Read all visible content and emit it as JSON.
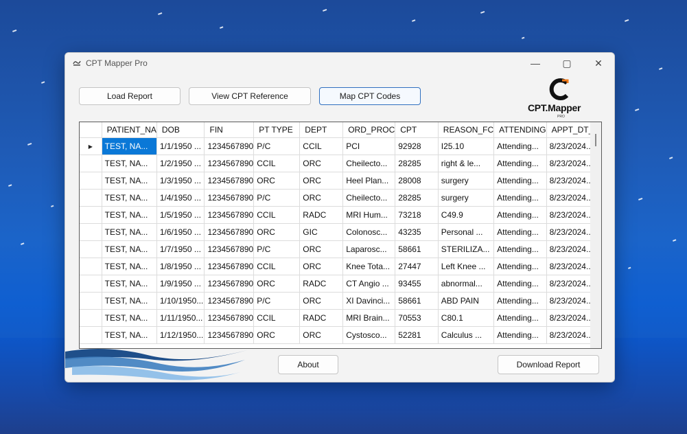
{
  "window": {
    "title": "CPT Mapper Pro",
    "minimize_label": "—",
    "maximize_label": "▢",
    "close_label": "✕"
  },
  "toolbar": {
    "load_report": "Load Report",
    "view_cpt_reference": "View CPT Reference",
    "map_cpt_codes": "Map CPT Codes"
  },
  "logo": {
    "text": "CPT.Mapper",
    "sub": "PRO",
    "accent_color": "#f07a1a"
  },
  "table": {
    "columns": [
      "PATIENT_NA",
      "DOB",
      "FIN",
      "PT TYPE",
      "DEPT",
      "ORD_PROC",
      "CPT",
      "REASON_FC",
      "ATTENDING",
      "APPT_DT_TI"
    ],
    "rows": [
      [
        "TEST, NA...",
        "1/1/1950 ...",
        "1234567890",
        "P/C",
        "CCIL",
        "PCI",
        "92928",
        "I25.10",
        "Attending...",
        "8/23/2024..."
      ],
      [
        "TEST, NA...",
        "1/2/1950 ...",
        "1234567890",
        "CCIL",
        "ORC",
        "Cheilecto...",
        "28285",
        "right & le...",
        "Attending...",
        "8/23/2024..."
      ],
      [
        "TEST, NA...",
        "1/3/1950 ...",
        "1234567890",
        "ORC",
        "ORC",
        "Heel Plan...",
        "28008",
        "surgery",
        "Attending...",
        "8/23/2024..."
      ],
      [
        "TEST, NA...",
        "1/4/1950 ...",
        "1234567890",
        "P/C",
        "ORC",
        "Cheilecto...",
        "28285",
        "surgery",
        "Attending...",
        "8/23/2024..."
      ],
      [
        "TEST, NA...",
        "1/5/1950 ...",
        "1234567890",
        "CCIL",
        "RADC",
        "MRI Hum...",
        "73218",
        "C49.9",
        "Attending...",
        "8/23/2024..."
      ],
      [
        "TEST, NA...",
        "1/6/1950 ...",
        "1234567890",
        "ORC",
        "GIC",
        "Colonosc...",
        "43235",
        "Personal ...",
        "Attending...",
        "8/23/2024..."
      ],
      [
        "TEST, NA...",
        "1/7/1950 ...",
        "1234567890",
        "P/C",
        "ORC",
        "Laparosc...",
        "58661",
        "STERILIZA...",
        "Attending...",
        "8/23/2024..."
      ],
      [
        "TEST, NA...",
        "1/8/1950 ...",
        "1234567890",
        "CCIL",
        "ORC",
        "Knee Tota...",
        "27447",
        "Left Knee ...",
        "Attending...",
        "8/23/2024..."
      ],
      [
        "TEST, NA...",
        "1/9/1950 ...",
        "1234567890",
        "ORC",
        "RADC",
        "CT Angio ...",
        "93455",
        "abnormal...",
        "Attending...",
        "8/23/2024..."
      ],
      [
        "TEST, NA...",
        "1/10/1950...",
        "1234567890",
        "P/C",
        "ORC",
        "XI Davinci...",
        "58661",
        "ABD PAIN",
        "Attending...",
        "8/23/2024..."
      ],
      [
        "TEST, NA...",
        "1/11/1950...",
        "1234567890",
        "CCIL",
        "RADC",
        "MRI Brain...",
        "70553",
        "C80.1",
        "Attending...",
        "8/23/2024..."
      ],
      [
        "TEST, NA...",
        "1/12/1950...",
        "1234567890",
        "ORC",
        "ORC",
        "Cystosco...",
        "52281",
        "Calculus ...",
        "Attending...",
        "8/23/2024..."
      ]
    ],
    "selected_row_indicator": "▶"
  },
  "footer": {
    "about": "About",
    "download_report": "Download Report"
  }
}
